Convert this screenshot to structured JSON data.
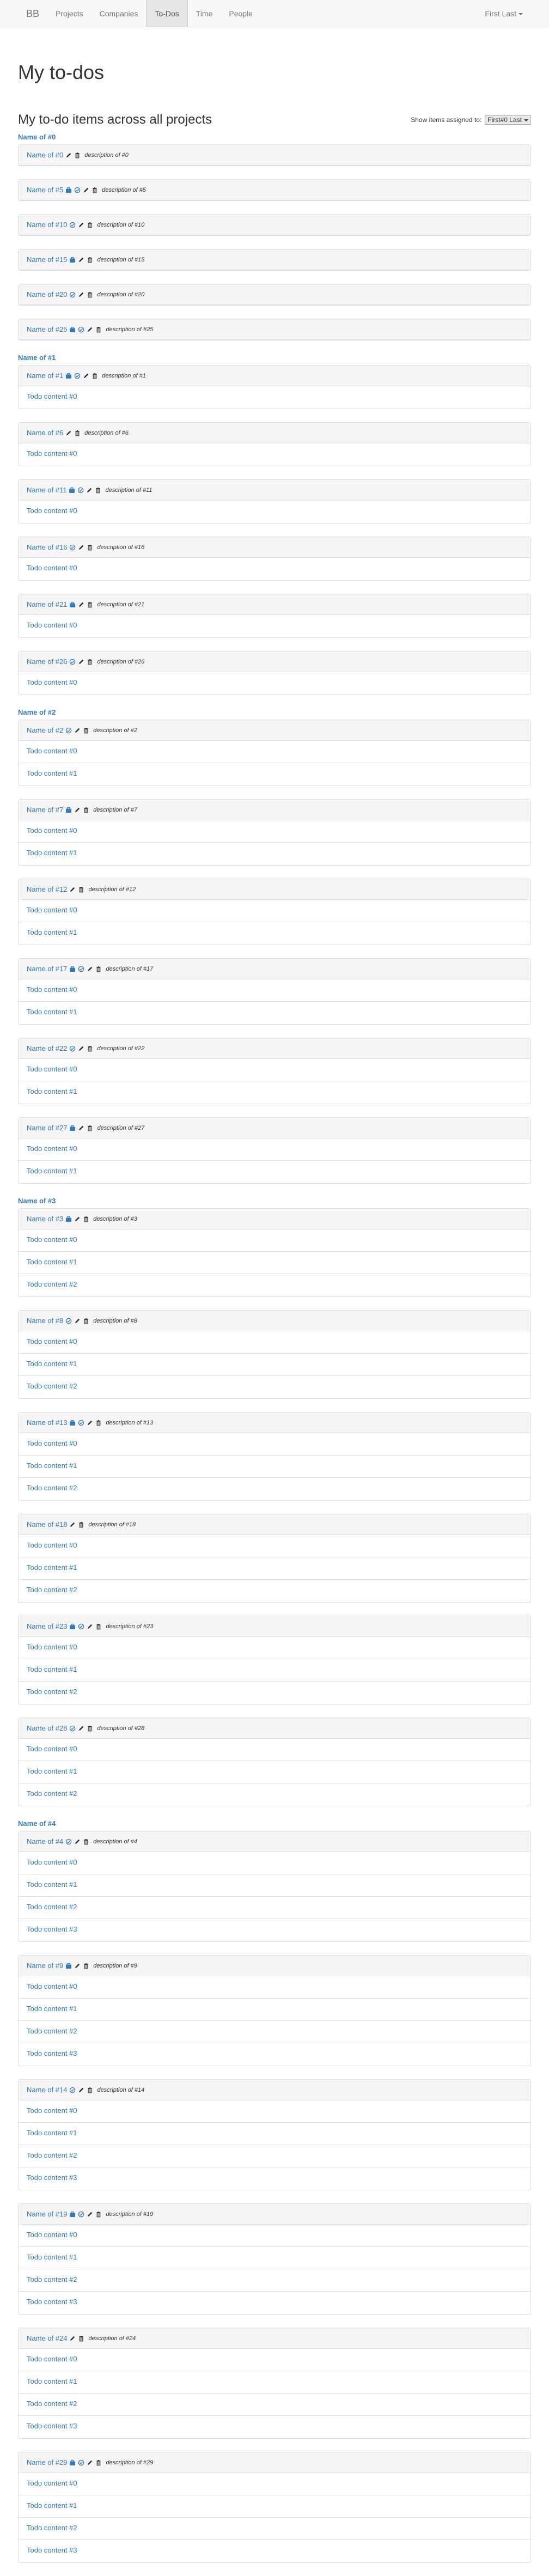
{
  "nav": {
    "brand": "BB",
    "items": [
      "Projects",
      "Companies",
      "To-Dos",
      "Time",
      "People"
    ],
    "active_index": 2,
    "user": "First Last"
  },
  "page": {
    "title": "My to-dos",
    "subtitle": "My to-do items across all projects",
    "filter_label": "Show items assigned to:",
    "filter_value": "First#0 Last"
  },
  "projects": [
    {
      "name": "Name of #0",
      "lists": [
        {
          "name": "Name of #0",
          "private": false,
          "lock": false,
          "desc": "description of #0",
          "todos": []
        },
        {
          "name": "Name of #5",
          "private": true,
          "lock": true,
          "desc": "description of #5",
          "todos": []
        },
        {
          "name": "Name of #10",
          "private": false,
          "lock": true,
          "desc": "description of #10",
          "todos": []
        },
        {
          "name": "Name of #15",
          "private": true,
          "lock": false,
          "desc": "description of #15",
          "todos": []
        },
        {
          "name": "Name of #20",
          "private": false,
          "lock": true,
          "desc": "description of #20",
          "todos": []
        },
        {
          "name": "Name of #25",
          "private": true,
          "lock": true,
          "desc": "description of #25",
          "todos": []
        }
      ]
    },
    {
      "name": "Name of #1",
      "lists": [
        {
          "name": "Name of #1",
          "private": true,
          "lock": true,
          "desc": "description of #1",
          "todos": [
            "Todo content #0"
          ]
        },
        {
          "name": "Name of #6",
          "private": false,
          "lock": false,
          "desc": "description of #6",
          "todos": [
            "Todo content #0"
          ]
        },
        {
          "name": "Name of #11",
          "private": true,
          "lock": true,
          "desc": "description of #11",
          "todos": [
            "Todo content #0"
          ]
        },
        {
          "name": "Name of #16",
          "private": false,
          "lock": true,
          "desc": "description of #16",
          "todos": [
            "Todo content #0"
          ]
        },
        {
          "name": "Name of #21",
          "private": true,
          "lock": false,
          "desc": "description of #21",
          "todos": [
            "Todo content #0"
          ]
        },
        {
          "name": "Name of #26",
          "private": false,
          "lock": true,
          "desc": "description of #26",
          "todos": [
            "Todo content #0"
          ]
        }
      ]
    },
    {
      "name": "Name of #2",
      "lists": [
        {
          "name": "Name of #2",
          "private": false,
          "lock": true,
          "desc": "description of #2",
          "todos": [
            "Todo content #0",
            "Todo content #1"
          ]
        },
        {
          "name": "Name of #7",
          "private": true,
          "lock": false,
          "desc": "description of #7",
          "todos": [
            "Todo content #0",
            "Todo content #1"
          ]
        },
        {
          "name": "Name of #12",
          "private": false,
          "lock": false,
          "desc": "description of #12",
          "todos": [
            "Todo content #0",
            "Todo content #1"
          ]
        },
        {
          "name": "Name of #17",
          "private": true,
          "lock": true,
          "desc": "description of #17",
          "todos": [
            "Todo content #0",
            "Todo content #1"
          ]
        },
        {
          "name": "Name of #22",
          "private": false,
          "lock": true,
          "desc": "description of #22",
          "todos": [
            "Todo content #0",
            "Todo content #1"
          ]
        },
        {
          "name": "Name of #27",
          "private": true,
          "lock": false,
          "desc": "description of #27",
          "todos": [
            "Todo content #0",
            "Todo content #1"
          ]
        }
      ]
    },
    {
      "name": "Name of #3",
      "lists": [
        {
          "name": "Name of #3",
          "private": true,
          "lock": false,
          "desc": "description of #3",
          "todos": [
            "Todo content #0",
            "Todo content #1",
            "Todo content #2"
          ]
        },
        {
          "name": "Name of #8",
          "private": false,
          "lock": true,
          "desc": "description of #8",
          "todos": [
            "Todo content #0",
            "Todo content #1",
            "Todo content #2"
          ]
        },
        {
          "name": "Name of #13",
          "private": true,
          "lock": true,
          "desc": "description of #13",
          "todos": [
            "Todo content #0",
            "Todo content #1",
            "Todo content #2"
          ]
        },
        {
          "name": "Name of #18",
          "private": false,
          "lock": false,
          "desc": "description of #18",
          "todos": [
            "Todo content #0",
            "Todo content #1",
            "Todo content #2"
          ]
        },
        {
          "name": "Name of #23",
          "private": true,
          "lock": true,
          "desc": "description of #23",
          "todos": [
            "Todo content #0",
            "Todo content #1",
            "Todo content #2"
          ]
        },
        {
          "name": "Name of #28",
          "private": false,
          "lock": true,
          "desc": "description of #28",
          "todos": [
            "Todo content #0",
            "Todo content #1",
            "Todo content #2"
          ]
        }
      ]
    },
    {
      "name": "Name of #4",
      "lists": [
        {
          "name": "Name of #4",
          "private": false,
          "lock": true,
          "desc": "description of #4",
          "todos": [
            "Todo content #0",
            "Todo content #1",
            "Todo content #2",
            "Todo content #3"
          ]
        },
        {
          "name": "Name of #9",
          "private": true,
          "lock": false,
          "desc": "description of #9",
          "todos": [
            "Todo content #0",
            "Todo content #1",
            "Todo content #2",
            "Todo content #3"
          ]
        },
        {
          "name": "Name of #14",
          "private": false,
          "lock": true,
          "desc": "description of #14",
          "todos": [
            "Todo content #0",
            "Todo content #1",
            "Todo content #2",
            "Todo content #3"
          ]
        },
        {
          "name": "Name of #19",
          "private": true,
          "lock": true,
          "desc": "description of #19",
          "todos": [
            "Todo content #0",
            "Todo content #1",
            "Todo content #2",
            "Todo content #3"
          ]
        },
        {
          "name": "Name of #24",
          "private": false,
          "lock": false,
          "desc": "description of #24",
          "todos": [
            "Todo content #0",
            "Todo content #1",
            "Todo content #2",
            "Todo content #3"
          ]
        },
        {
          "name": "Name of #29",
          "private": true,
          "lock": true,
          "desc": "description of #29",
          "todos": [
            "Todo content #0",
            "Todo content #1",
            "Todo content #2",
            "Todo content #3"
          ]
        }
      ]
    }
  ],
  "icons": {
    "private": "briefcase-icon",
    "lock": "lock-icon",
    "edit": "pencil-icon",
    "delete": "trash-icon"
  },
  "colors": {
    "link": "#337ab7",
    "panel_header": "#f5f5f5",
    "border": "#ddd"
  }
}
